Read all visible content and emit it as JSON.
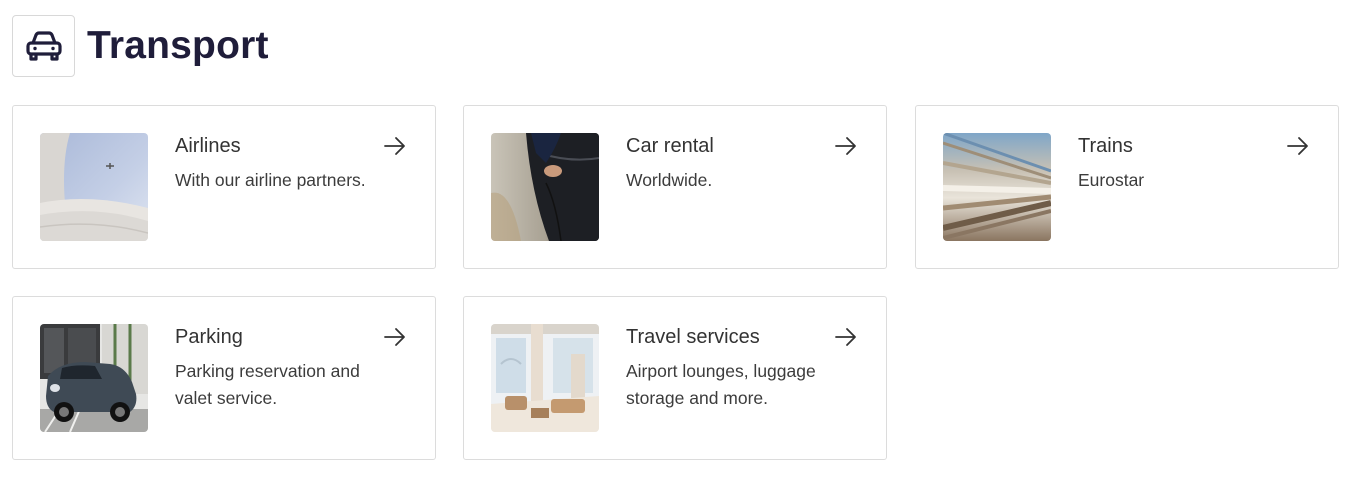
{
  "header": {
    "title": "Transport",
    "icon": "car-icon"
  },
  "colors": {
    "title": "#1f1d3a",
    "card_border": "#dcdcdc",
    "text": "#333333"
  },
  "cards": [
    {
      "title": "Airlines",
      "description": "With our airline partners.",
      "image": "airplane-sky-photo",
      "arrow": "arrow-right-icon"
    },
    {
      "title": "Car rental",
      "description": "Worldwide.",
      "image": "car-door-photo",
      "arrow": "arrow-right-icon"
    },
    {
      "title": "Trains",
      "description": "Eurostar",
      "image": "train-motion-photo",
      "arrow": "arrow-right-icon"
    },
    {
      "title": "Parking",
      "description": "Parking reservation and valet service.",
      "image": "parked-car-photo",
      "arrow": "arrow-right-icon"
    },
    {
      "title": "Travel services",
      "description": "Airport lounges, luggage storage and more.",
      "image": "lounge-photo",
      "arrow": "arrow-right-icon"
    }
  ]
}
